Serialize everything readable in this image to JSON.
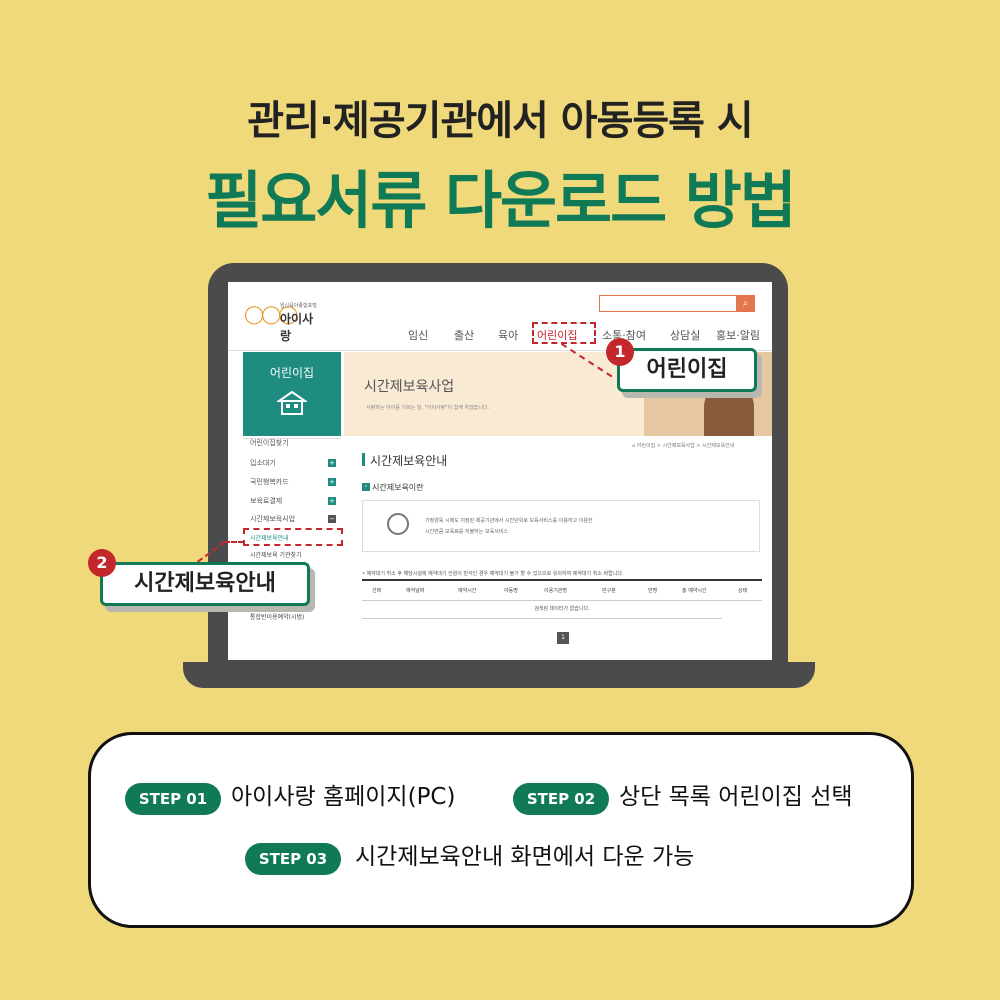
{
  "title": {
    "line1": "관리·제공기관에서 아동등록 시",
    "line2": "필요서류 다운로드 방법"
  },
  "colors": {
    "background": "#f0d97a",
    "accent_green": "#0f7a55",
    "callout_red": "#c4272b",
    "site_teal": "#1e8c80"
  },
  "site": {
    "logo_sub": "임신육아종합포털",
    "logo_name": "아이사랑",
    "search_icon": "search-icon",
    "gnb": [
      "임신",
      "출산",
      "육아",
      "어린이집",
      "소통·참여",
      "상담실",
      "홍보·알림"
    ],
    "lnb_title": "어린이집",
    "lnb_icon": "house-icon",
    "lnb_items": [
      "어린이집찾기",
      "입소대기",
      "국민행복카드",
      "보육료결제",
      "시간제보육사업"
    ],
    "lnb_subitems": [
      "시간제보육안내",
      "시간제보육 기관찾기",
      "통합반이용예약(시범)"
    ],
    "banner_title": "시간제보육사업",
    "banner_sub": "사랑하는 아이를 기르는 일, \"아이사랑\"이 함께 하겠습니다.",
    "breadcrumb": "어린이집 > 시간제보육사업 > 시간제보육안내",
    "content_title": "시간제보육안내",
    "section_title": "시간제보육이란",
    "info_line1": "가정양육 시에도 지정된 제공기관에서 시간단위로 보육서비스를 이용하고 이용한",
    "info_line2": "시간만큼 보육료를 지불하는 보육서비스",
    "note": "예약대기 취소 후 해당시설에 예약대기 인원이 만석인 경우 예약대기 불가 할 수 있으므로 유의하여 예약대기 취소 바랍니다.",
    "table_headers": [
      "선택",
      "예약날짜",
      "예약시간",
      "아동명",
      "이용기관명",
      "반구분",
      "반명",
      "총 예약시간",
      "상태"
    ],
    "table_empty": "검색된 데이터가 없습니다.",
    "page": "1"
  },
  "callouts": [
    {
      "num": "1",
      "label": "어린이집"
    },
    {
      "num": "2",
      "label": "시간제보육안내"
    }
  ],
  "steps": [
    {
      "tag": "STEP 01",
      "text": "아이사랑 홈페이지(PC)"
    },
    {
      "tag": "STEP 02",
      "text": "상단 목록 어린이집 선택"
    },
    {
      "tag": "STEP 03",
      "text": "시간제보육안내 화면에서 다운 가능"
    }
  ]
}
